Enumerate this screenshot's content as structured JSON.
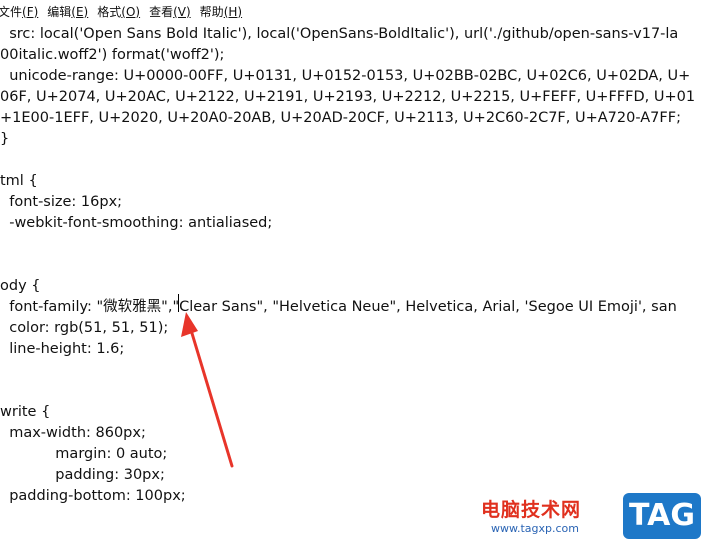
{
  "menu": {
    "items": [
      {
        "label": "文件",
        "accel": "(F)"
      },
      {
        "label": "编辑",
        "accel": "(E)"
      },
      {
        "label": "格式",
        "accel": "(O)"
      },
      {
        "label": "查看",
        "accel": "(V)"
      },
      {
        "label": "帮助",
        "accel": "(H)"
      }
    ]
  },
  "editor": {
    "lines": [
      "  src: local('Open Sans Bold Italic'), local('OpenSans-BoldItalic'), url('./github/open-sans-v17-la",
      "00italic.woff2') format('woff2');",
      "  unicode-range: U+0000-00FF, U+0131, U+0152-0153, U+02BB-02BC, U+02C6, U+02DA, U+",
      "06F, U+2074, U+20AC, U+2122, U+2191, U+2193, U+2212, U+2215, U+FEFF, U+FFFD, U+01",
      "+1E00-1EFF, U+2020, U+20A0-20AB, U+20AD-20CF, U+2113, U+2C60-2C7F, U+A720-A7FF;",
      "}",
      "",
      "tml {",
      "  font-size: 16px;",
      "  -webkit-font-smoothing: antialiased;",
      "",
      "",
      "ody {",
      "  font-family: \"微软雅黑\",\"Clear Sans\", \"Helvetica Neue\", Helvetica, Arial, 'Segoe UI Emoji', san",
      "  color: rgb(51, 51, 51);",
      "  line-height: 1.6;",
      "",
      "",
      "write {",
      "  max-width: 860px;",
      "            margin: 0 auto;",
      "            padding: 30px;",
      "  padding-bottom: 100px;"
    ]
  },
  "annotation": {
    "arrow_color": "#e8352a"
  },
  "watermark": {
    "site_name": "电脑技术网",
    "url": "www.tagxp.com",
    "tag_text": "TAG",
    "red": "#e0301e",
    "blue": "#1e78c8"
  }
}
